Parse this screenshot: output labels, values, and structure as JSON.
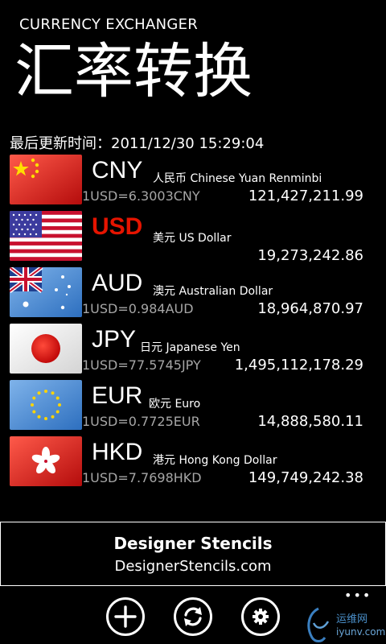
{
  "app": {
    "subtitle": "CURRENCY EXCHANGER",
    "title": "汇率转换",
    "updated": "最后更新时间：2011/12/30 15:29:04"
  },
  "rates": [
    {
      "code": "CNY",
      "name": "人民币 Chinese Yuan Renminbi",
      "rate": "1USD=6.3003CNY",
      "amount": "121,427,211.99",
      "flag": "china-flag-icon",
      "highlight": false
    },
    {
      "code": "USD",
      "name": "美元 US Dollar",
      "rate": "",
      "amount": "19,273,242.86",
      "flag": "us-flag-icon",
      "highlight": true
    },
    {
      "code": "AUD",
      "name": "澳元 Australian Dollar",
      "rate": "1USD=0.984AUD",
      "amount": "18,964,870.97",
      "flag": "australia-flag-icon",
      "highlight": false
    },
    {
      "code": "JPY",
      "name": "日元 Japanese Yen",
      "rate": "1USD=77.5745JPY",
      "amount": "1,495,112,178.29",
      "flag": "japan-flag-icon",
      "highlight": false
    },
    {
      "code": "EUR",
      "name": "欧元 Euro",
      "rate": "1USD=0.7725EUR",
      "amount": "14,888,580.11",
      "flag": "eu-flag-icon",
      "highlight": false
    },
    {
      "code": "HKD",
      "name": "港元 Hong Kong Dollar",
      "rate": "1USD=7.7698HKD",
      "amount": "149,749,242.38",
      "flag": "hong-kong-flag-icon",
      "highlight": false
    }
  ],
  "ad": {
    "title": "Designer Stencils",
    "url": "DesignerStencils.com"
  },
  "appbar": {
    "buttons": [
      "add-icon",
      "refresh-icon",
      "settings-icon"
    ],
    "more": "•••"
  },
  "watermark": {
    "text": "运维网",
    "url": "iyunv.com"
  },
  "colors": {
    "background": "#000000",
    "highlight": "#e51400",
    "secondary_text": "#a6a6a6"
  }
}
